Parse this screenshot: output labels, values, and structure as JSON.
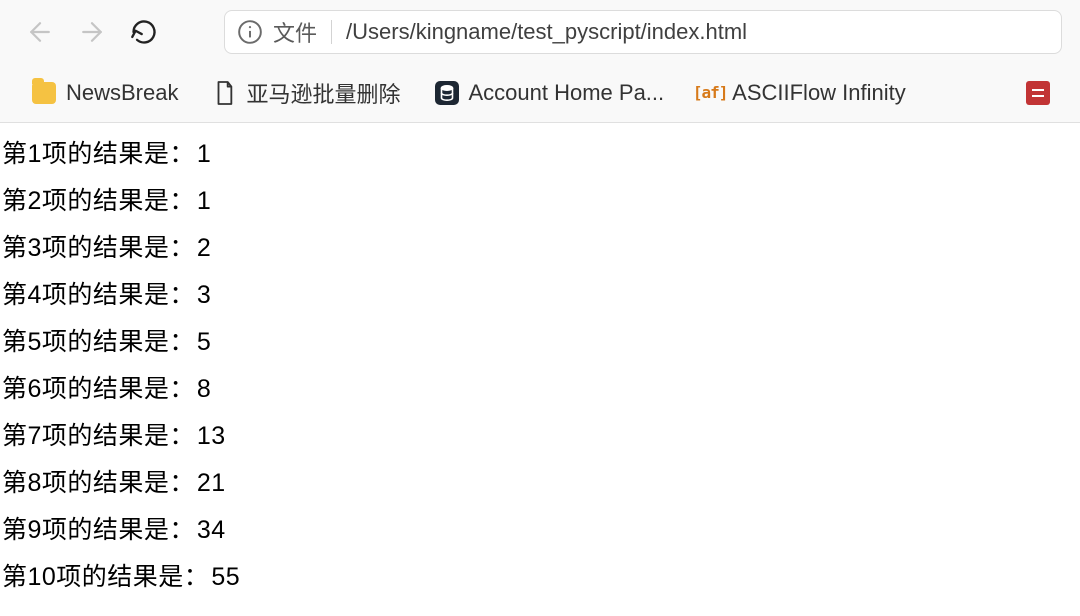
{
  "toolbar": {
    "file_label": "文件",
    "url": "/Users/kingname/test_pyscript/index.html"
  },
  "bookmarks": [
    {
      "label": "NewsBreak",
      "icon": "folder"
    },
    {
      "label": "亚马逊批量删除",
      "icon": "page"
    },
    {
      "label": "Account Home Pa...",
      "icon": "db"
    },
    {
      "label": "ASCIIFlow Infinity",
      "icon": "af"
    }
  ],
  "results": [
    {
      "label": "第1项的结果是：",
      "value": "1"
    },
    {
      "label": "第2项的结果是：",
      "value": "1"
    },
    {
      "label": "第3项的结果是：",
      "value": "2"
    },
    {
      "label": "第4项的结果是：",
      "value": "3"
    },
    {
      "label": "第5项的结果是：",
      "value": "5"
    },
    {
      "label": "第6项的结果是：",
      "value": "8"
    },
    {
      "label": "第7项的结果是：",
      "value": "13"
    },
    {
      "label": "第8项的结果是：",
      "value": "21"
    },
    {
      "label": "第9项的结果是：",
      "value": "34"
    },
    {
      "label": "第10项的结果是：",
      "value": "55"
    }
  ]
}
